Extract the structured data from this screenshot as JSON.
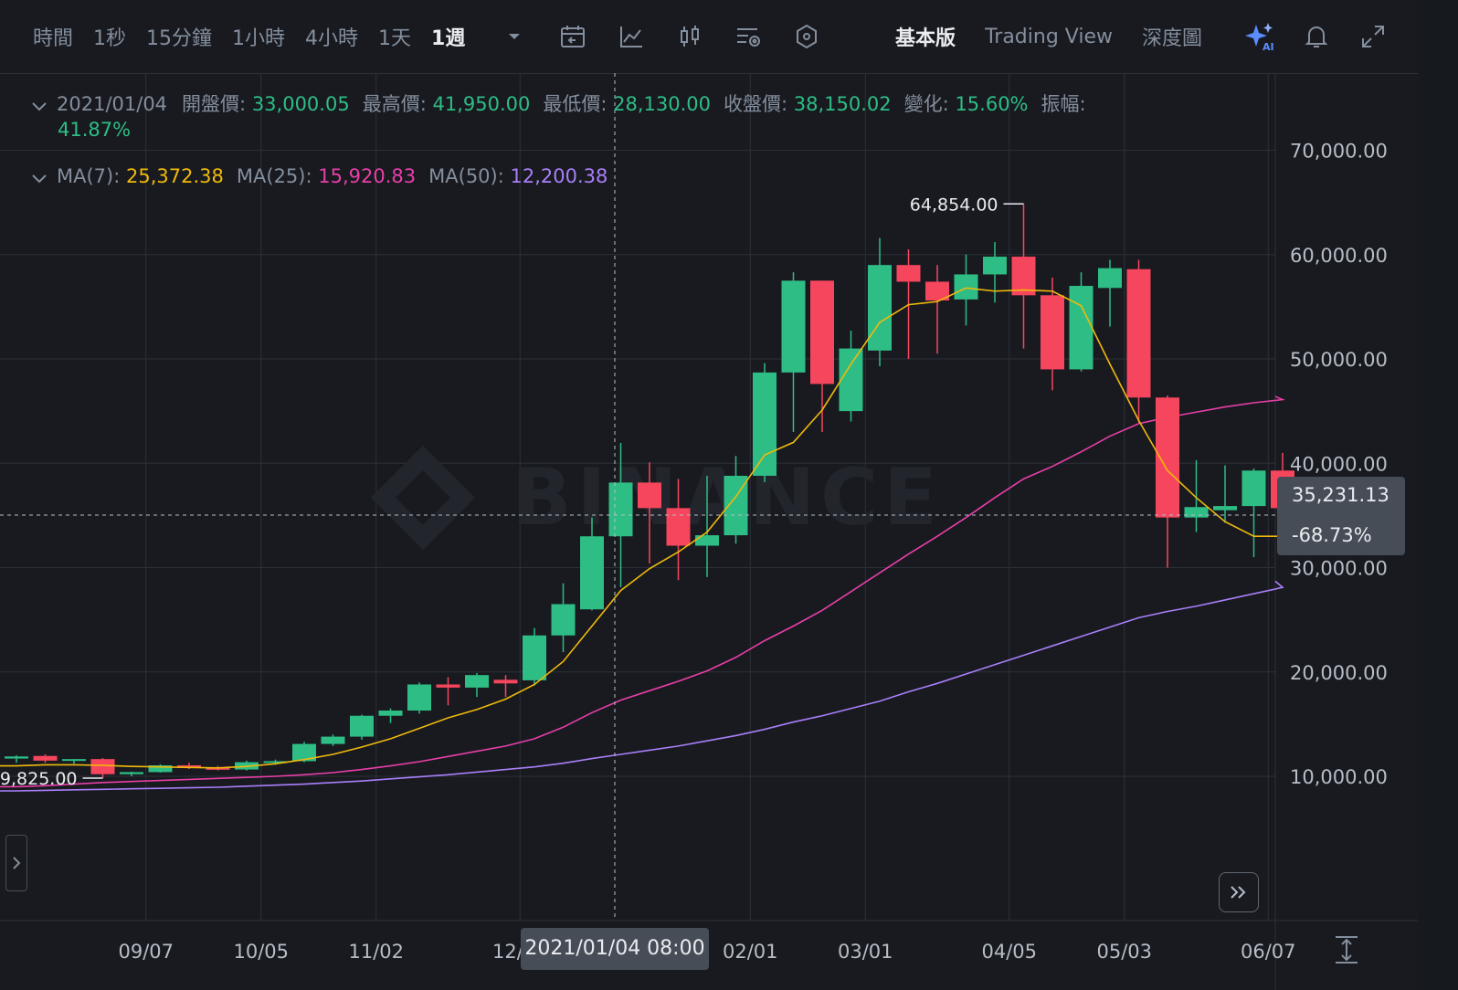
{
  "toolbar": {
    "timeframes": [
      {
        "label": "時間",
        "active": false
      },
      {
        "label": "1秒",
        "active": false
      },
      {
        "label": "15分鐘",
        "active": false
      },
      {
        "label": "1小時",
        "active": false
      },
      {
        "label": "4小時",
        "active": false
      },
      {
        "label": "1天",
        "active": false
      },
      {
        "label": "1週",
        "active": true
      }
    ],
    "icons": [
      "chevron-down-icon",
      "calendar-icon",
      "indicator-icon",
      "candlestick-type-icon",
      "chart-settings-icon",
      "drawing-tools-icon"
    ],
    "views": [
      {
        "label": "基本版",
        "active": true
      },
      {
        "label": "Trading View",
        "active": false
      },
      {
        "label": "深度圖",
        "active": false
      }
    ],
    "right_icons": [
      "ai-sparkle-icon",
      "bell-icon",
      "fullscreen-icon"
    ]
  },
  "ohlc": {
    "date": "2021/01/04",
    "open_label": "開盤價:",
    "open": "33,000.05",
    "high_label": "最高價:",
    "high": "41,950.00",
    "low_label": "最低價:",
    "low": "28,130.00",
    "close_label": "收盤價:",
    "close": "38,150.02",
    "change_label": "變化:",
    "change": "15.60%",
    "amp_label": "振幅:",
    "amp": "41.87%"
  },
  "ma": {
    "ma7_label": "MA(7):",
    "ma7": "25,372.38",
    "ma25_label": "MA(25):",
    "ma25": "15,920.83",
    "ma50_label": "MA(50):",
    "ma50": "12,200.38"
  },
  "crosshair": {
    "price": "35,231.13",
    "change": "-68.73%",
    "time": "2021/01/04 08:00"
  },
  "watermark": "BINANCE",
  "colors": {
    "up": "#2ebd85",
    "down": "#f6465d",
    "ma7": "#f0b90b",
    "ma25": "#e83fa8",
    "ma50": "#a97ff9",
    "grid": "#2b3139",
    "bg": "#181a20"
  },
  "chart_data": {
    "type": "candlestick",
    "yticks": [
      10000,
      20000,
      30000,
      40000,
      50000,
      60000,
      70000
    ],
    "ytick_labels": [
      "10,000.00",
      "20,000.00",
      "30,000.00",
      "40,000.00",
      "50,000.00",
      "60,000.00",
      "70,000.00"
    ],
    "xtick_labels": [
      "09/07",
      "10/05",
      "11/02",
      "12/07",
      "02/01",
      "03/01",
      "04/05",
      "05/03",
      "06/07"
    ],
    "max_annotation": "64,854.00",
    "min_annotation": "9,825.00",
    "candles": [
      {
        "o": 11700,
        "h": 12000,
        "l": 11300,
        "c": 11900
      },
      {
        "o": 11950,
        "h": 12100,
        "l": 11300,
        "c": 11500
      },
      {
        "o": 11500,
        "h": 11650,
        "l": 11200,
        "c": 11650
      },
      {
        "o": 11650,
        "h": 11750,
        "l": 9825,
        "c": 10200
      },
      {
        "o": 10200,
        "h": 10450,
        "l": 10000,
        "c": 10400
      },
      {
        "o": 10400,
        "h": 11150,
        "l": 10350,
        "c": 11050
      },
      {
        "o": 11050,
        "h": 11300,
        "l": 10700,
        "c": 10800
      },
      {
        "o": 10800,
        "h": 11000,
        "l": 10550,
        "c": 10650
      },
      {
        "o": 10650,
        "h": 11500,
        "l": 10550,
        "c": 11350
      },
      {
        "o": 11350,
        "h": 11600,
        "l": 11100,
        "c": 11450
      },
      {
        "o": 11450,
        "h": 13300,
        "l": 11350,
        "c": 13100
      },
      {
        "o": 13100,
        "h": 14000,
        "l": 12900,
        "c": 13800
      },
      {
        "o": 13800,
        "h": 15900,
        "l": 13500,
        "c": 15800
      },
      {
        "o": 15800,
        "h": 16500,
        "l": 15100,
        "c": 16300
      },
      {
        "o": 16300,
        "h": 19000,
        "l": 16000,
        "c": 18800
      },
      {
        "o": 18800,
        "h": 19500,
        "l": 16800,
        "c": 18500
      },
      {
        "o": 18500,
        "h": 19900,
        "l": 17600,
        "c": 19700
      },
      {
        "o": 19250,
        "h": 19700,
        "l": 17600,
        "c": 18900
      },
      {
        "o": 19200,
        "h": 24200,
        "l": 18700,
        "c": 23500
      },
      {
        "o": 23500,
        "h": 28500,
        "l": 21900,
        "c": 26500
      },
      {
        "o": 26000,
        "h": 34800,
        "l": 25900,
        "c": 33000
      },
      {
        "o": 33000,
        "h": 41950,
        "l": 28130,
        "c": 38150
      },
      {
        "o": 38150,
        "h": 40100,
        "l": 30400,
        "c": 35700
      },
      {
        "o": 35700,
        "h": 38500,
        "l": 28800,
        "c": 32100
      },
      {
        "o": 32100,
        "h": 38800,
        "l": 29100,
        "c": 33100
      },
      {
        "o": 33100,
        "h": 40700,
        "l": 32300,
        "c": 38800
      },
      {
        "o": 38800,
        "h": 49600,
        "l": 38200,
        "c": 48700
      },
      {
        "o": 48700,
        "h": 58300,
        "l": 43000,
        "c": 57500
      },
      {
        "o": 57500,
        "h": 57500,
        "l": 43000,
        "c": 47600
      },
      {
        "o": 45000,
        "h": 52700,
        "l": 44000,
        "c": 51000
      },
      {
        "o": 50800,
        "h": 61600,
        "l": 49300,
        "c": 59000
      },
      {
        "o": 59000,
        "h": 60500,
        "l": 50000,
        "c": 57400
      },
      {
        "o": 57400,
        "h": 59000,
        "l": 50500,
        "c": 55600
      },
      {
        "o": 55700,
        "h": 60000,
        "l": 53200,
        "c": 58100
      },
      {
        "o": 58100,
        "h": 61200,
        "l": 55400,
        "c": 59800
      },
      {
        "o": 59800,
        "h": 64854,
        "l": 51000,
        "c": 56100
      },
      {
        "o": 56100,
        "h": 57800,
        "l": 47000,
        "c": 49000
      },
      {
        "o": 49000,
        "h": 58300,
        "l": 48800,
        "c": 57000
      },
      {
        "o": 56800,
        "h": 59500,
        "l": 53100,
        "c": 58700
      },
      {
        "o": 58600,
        "h": 59500,
        "l": 43900,
        "c": 46300
      },
      {
        "o": 46300,
        "h": 46500,
        "l": 30000,
        "c": 34800
      },
      {
        "o": 34800,
        "h": 40300,
        "l": 33400,
        "c": 35800
      },
      {
        "o": 35500,
        "h": 39800,
        "l": 34300,
        "c": 35900
      },
      {
        "o": 35900,
        "h": 39500,
        "l": 31000,
        "c": 39300
      },
      {
        "o": 39300,
        "h": 41000,
        "l": 33200,
        "c": 35700
      }
    ],
    "ma7": [
      11000,
      11100,
      11100,
      11050,
      10950,
      10900,
      10850,
      10800,
      10950,
      11200,
      11600,
      12100,
      12800,
      13600,
      14600,
      15600,
      16400,
      17400,
      18800,
      21000,
      24400,
      27800,
      29900,
      31500,
      33400,
      36800,
      40800,
      42000,
      45100,
      49500,
      53500,
      55200,
      55500,
      56800,
      56500,
      56600,
      56500,
      55100,
      49500,
      44100,
      39300,
      36700,
      34400,
      33000,
      33000
    ],
    "ma25": [
      9000,
      9100,
      9250,
      9400,
      9500,
      9600,
      9700,
      9800,
      9900,
      10000,
      10150,
      10350,
      10650,
      11000,
      11400,
      11900,
      12400,
      12900,
      13600,
      14700,
      16100,
      17300,
      18200,
      19100,
      20100,
      21400,
      23000,
      24400,
      25900,
      27700,
      29500,
      31300,
      33000,
      34800,
      36700,
      38500,
      39700,
      41100,
      42600,
      43800,
      44400,
      44900,
      45400,
      45800,
      46100
    ],
    "ma50": [
      8600,
      8650,
      8700,
      8750,
      8800,
      8850,
      8900,
      8950,
      9050,
      9150,
      9250,
      9400,
      9550,
      9750,
      9950,
      10150,
      10400,
      10650,
      10900,
      11250,
      11700,
      12100,
      12500,
      12900,
      13400,
      13900,
      14500,
      15200,
      15800,
      16500,
      17200,
      18100,
      18900,
      19800,
      20700,
      21600,
      22500,
      23400,
      24300,
      25200,
      25800,
      26300,
      26900,
      27500,
      28100
    ]
  }
}
